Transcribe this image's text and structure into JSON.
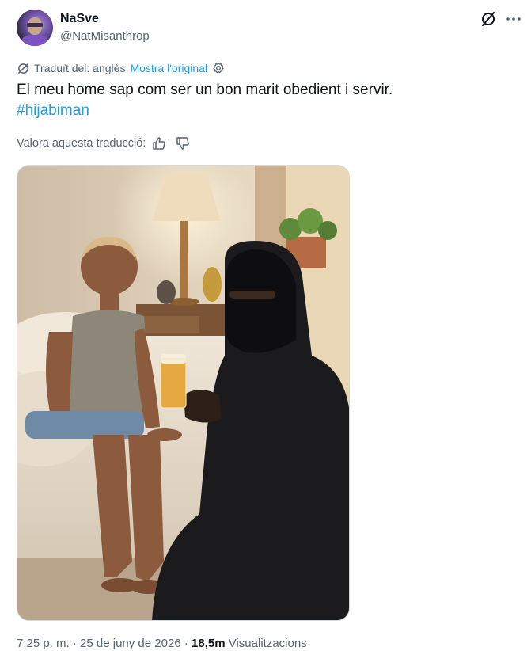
{
  "author": {
    "display_name": "NaSve",
    "handle": "@NatMisanthrop"
  },
  "icons": {
    "grok": "grok-slash-icon",
    "more": "more-horizontal-icon",
    "translate": "translate-icon",
    "settings": "gear-icon",
    "thumbs_up": "thumbs-up-icon",
    "thumbs_down": "thumbs-down-icon"
  },
  "translation": {
    "label": "Traduït del: anglès",
    "show_original": "Mostra l'original"
  },
  "tweet": {
    "text": "El meu home sap com ser un bon marit obedient i servir.",
    "hashtag": "#hijabiman"
  },
  "rating": {
    "label": "Valora aquesta traducció:"
  },
  "meta": {
    "time": "7:25 p. m.",
    "separator": "·",
    "date": "25 de juny de 2026",
    "views_count": "18,5m",
    "views_label": "Visualitzacions"
  },
  "colors": {
    "accent": "#1d9bf0",
    "text_primary": "#0f1419",
    "text_secondary": "#536471",
    "border": "#cfd9de"
  }
}
